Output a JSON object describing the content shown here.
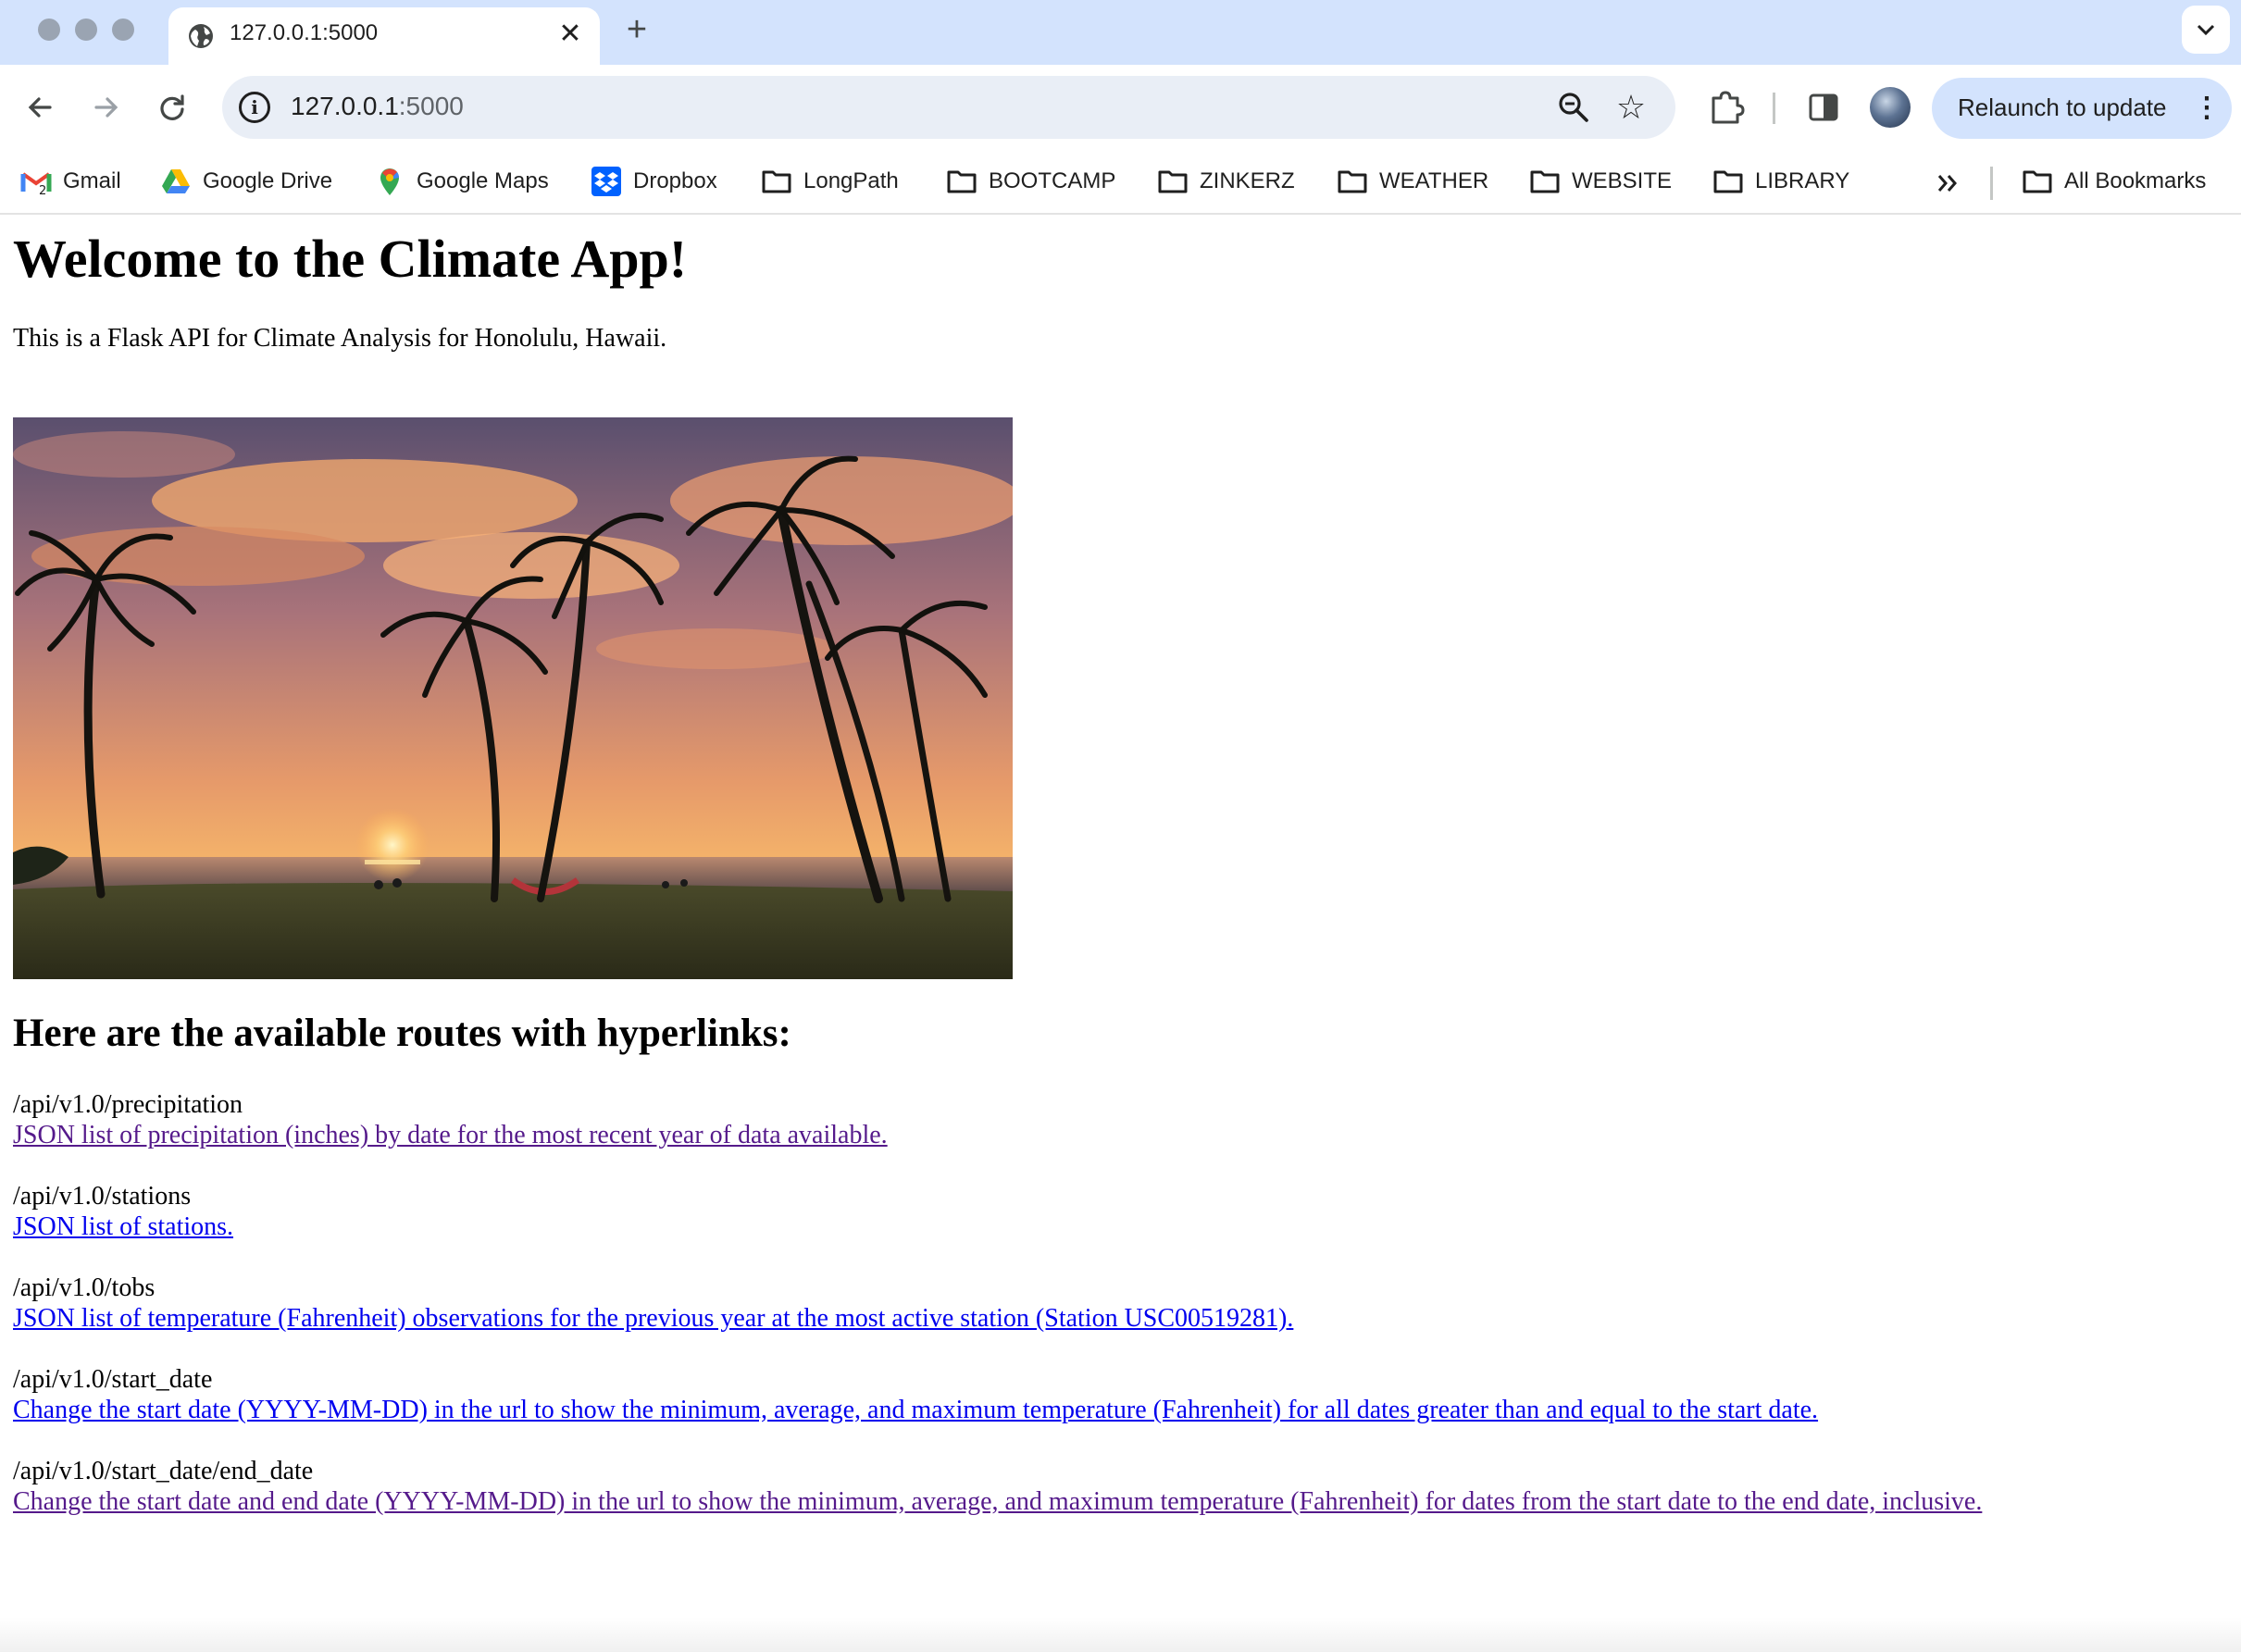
{
  "browser": {
    "tab": {
      "title": "127.0.0.1:5000"
    },
    "address_bar": {
      "host": "127.0.0.1",
      "port": ":5000"
    },
    "relaunch_label": "Relaunch to update",
    "bookmarks": [
      {
        "label": "Gmail",
        "icon": "gmail-icon"
      },
      {
        "label": "Google Drive",
        "icon": "google-drive-icon"
      },
      {
        "label": "Google Maps",
        "icon": "google-maps-icon"
      },
      {
        "label": "Dropbox",
        "icon": "dropbox-icon"
      },
      {
        "label": "LongPath",
        "icon": "folder-icon"
      },
      {
        "label": "BOOTCAMP",
        "icon": "folder-icon"
      },
      {
        "label": "ZINKERZ",
        "icon": "folder-icon"
      },
      {
        "label": "WEATHER",
        "icon": "folder-icon"
      },
      {
        "label": "WEBSITE",
        "icon": "folder-icon"
      },
      {
        "label": "LIBRARY",
        "icon": "folder-icon"
      }
    ],
    "all_bookmarks_label": "All Bookmarks",
    "colors": {
      "tabstrip": "#d3e3fd",
      "omnibox": "#e9eef6",
      "relaunch": "#d3e3fd"
    }
  },
  "page": {
    "title": "Welcome to the Climate App!",
    "intro": "This is a Flask API for Climate Analysis for Honolulu, Hawaii.",
    "image_subject": "sunset-palm-trees-beach",
    "routes_heading": "Here are the available routes with hyperlinks:",
    "routes": [
      {
        "path": "/api/v1.0/precipitation",
        "link": "JSON list of precipitation (inches) by date for the most recent year of data available.",
        "visited": true
      },
      {
        "path": "/api/v1.0/stations",
        "link": "JSON list of stations.",
        "visited": false
      },
      {
        "path": "/api/v1.0/tobs",
        "link": "JSON list of temperature (Fahrenheit) observations for the previous year at the most active station (Station USC00519281).",
        "visited": false
      },
      {
        "path": "/api/v1.0/start_date",
        "link": "Change the start date (YYYY-MM-DD) in the url to show the minimum, average, and maximum temperature (Fahrenheit) for all dates greater than and equal to the start date.",
        "visited": false
      },
      {
        "path": "/api/v1.0/start_date/end_date",
        "link": "Change the start date and end date (YYYY-MM-DD) in the url to show the minimum, average, and maximum temperature (Fahrenheit) for dates from the start date to the end date, inclusive.",
        "visited": true
      }
    ],
    "colors": {
      "link_visited": "#551a8b",
      "link_unvisited": "#0000ee"
    }
  }
}
